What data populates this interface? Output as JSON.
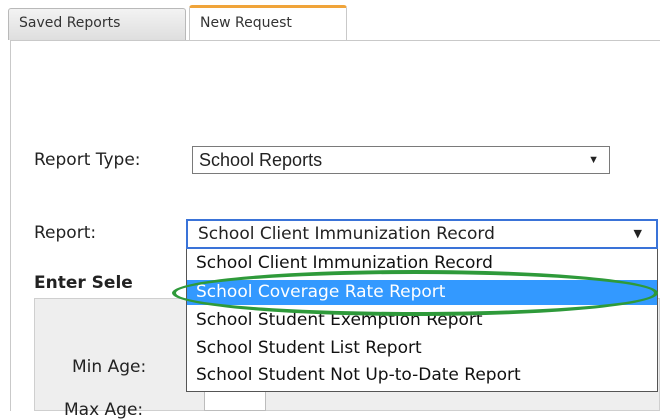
{
  "tabs": [
    {
      "label": "Saved Reports",
      "active": false
    },
    {
      "label": "New Request",
      "active": true
    }
  ],
  "form": {
    "report_type_label": "Report Type:",
    "report_type_value": "School Reports",
    "report_label": "Report:",
    "report_value": "School Client Immunization Record",
    "dropdown_options": [
      "School Client Immunization Record",
      "School Coverage Rate Report",
      "School Student Exemption Report",
      "School Student List Report",
      "School Student Not Up-to-Date Report"
    ],
    "highlighted_option_index": 1,
    "section_heading": "Enter Sele",
    "min_age_label": "Min Age:",
    "max_age_label": "Max Age:"
  },
  "colors": {
    "active_tab_accent": "#f0a43a",
    "selected_option_bg": "#3399ff",
    "annotation_ring": "#2e9a3a"
  },
  "icons": {
    "dropdown_arrow": "caret-down-icon"
  }
}
